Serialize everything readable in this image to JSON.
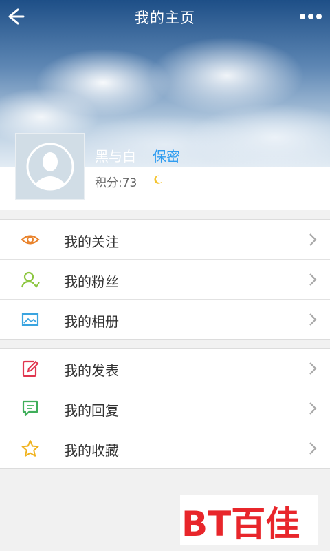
{
  "topbar": {
    "title": "我的主页",
    "back_icon": "back-arrow-icon",
    "more_icon": "more-dots-icon"
  },
  "profile": {
    "username": "黑与白",
    "privacy_label": "保密",
    "score": "积分:73",
    "avatar_icon": "default-avatar-icon",
    "level_icon": "moon-icon"
  },
  "menu_group_1": [
    {
      "label": "我的关注",
      "icon": "eye-icon",
      "color": "#e9832c"
    },
    {
      "label": "我的粉丝",
      "icon": "user-heart-icon",
      "color": "#8cc63f"
    },
    {
      "label": "我的相册",
      "icon": "image-icon",
      "color": "#3aa4e0"
    }
  ],
  "menu_group_2": [
    {
      "label": "我的发表",
      "icon": "edit-icon",
      "color": "#e0354e"
    },
    {
      "label": "我的回复",
      "icon": "comment-icon",
      "color": "#3fae5a"
    },
    {
      "label": "我的收藏",
      "icon": "star-icon",
      "color": "#f0b21d"
    }
  ],
  "watermark": {
    "text": "BT百佳",
    "logo_color": "#e8262b"
  }
}
